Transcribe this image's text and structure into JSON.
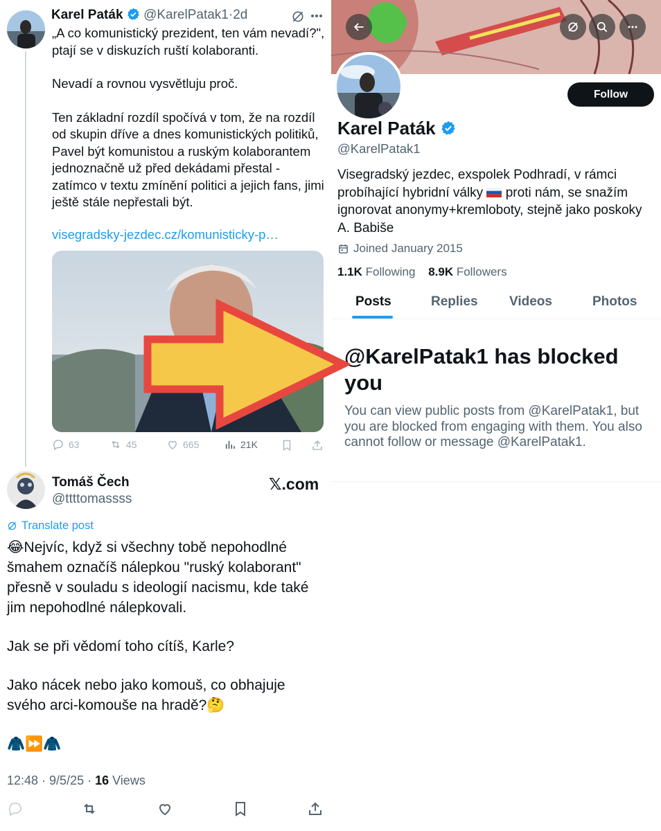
{
  "tweet": {
    "name": "Karel Paták",
    "handle": "@KarelPatak1",
    "time": "2d",
    "paragraphs": [
      "„A co komunistický prezident, ten vám nevadí?\", ptají se v diskuzích ruští kolaboranti.",
      "Nevadí a rovnou vysvětluju proč.",
      "Ten základní rozdíl spočívá v tom, že na rozdíl od skupin dříve a dnes komunistických politiků, Pavel být komunistou a ruským kolaborantem jednoznačně už před dekádami přestal - zatímco v textu zmínění politici a jejich fans, jimi ještě stále nepřestali být."
    ],
    "link": "visegradsky-jezdec.cz/komunisticky-p…",
    "replies": "63",
    "reposts": "45",
    "likes": "665",
    "views": "21K"
  },
  "reply": {
    "name": "Tomáš Čech",
    "handle": "@ttttomassss",
    "brand": "𝕏.com",
    "translate": "Translate post",
    "paragraphs": [
      "😂Nejvíc, když si všechny tobě nepohodlné šmahem označíš nálepkou \"ruský kolaborant\" přesně v souladu s ideologií nacismu, kde také jim nepohodlné nálepkovali.",
      "Jak se při vědomí toho cítíš, Karle?",
      "Jako nácek nebo jako komouš, co obhajuje svého arci-komouše na hradě?🤔",
      "🧥⏩🧥"
    ],
    "time": "12:48 · 9/5/25 · ",
    "views_count": "16",
    "views_label": " Views"
  },
  "profile": {
    "name": "Karel Paták",
    "handle": "@KarelPatak1",
    "follow_label": "Follow",
    "bio_before_flag": "Visegradský jezdec, exspolek Podhradí, v rámci probíhající hybridní války ",
    "bio_after_flag": " proti nám, se snažím ignorovat anonymy+kremloboty, stejně jako poskoky A. Babiše",
    "joined": "Joined January 2015",
    "following_count": "1.1K",
    "following_label": " Following",
    "followers_count": "8.9K",
    "followers_label": " Followers",
    "tabs": [
      "Posts",
      "Replies",
      "Videos",
      "Photos"
    ],
    "blocked_title": "@KarelPatak1 has blocked you",
    "blocked_message": "You can view public posts from @KarelPatak1, but you are blocked from engaging with them. You also cannot follow or message @KarelPatak1."
  },
  "colors": {
    "accent": "#1d9bf0",
    "text": "#0f1419",
    "muted": "#536471",
    "arrow_fill": "#f6c84a",
    "arrow_stroke": "#e8473f"
  }
}
